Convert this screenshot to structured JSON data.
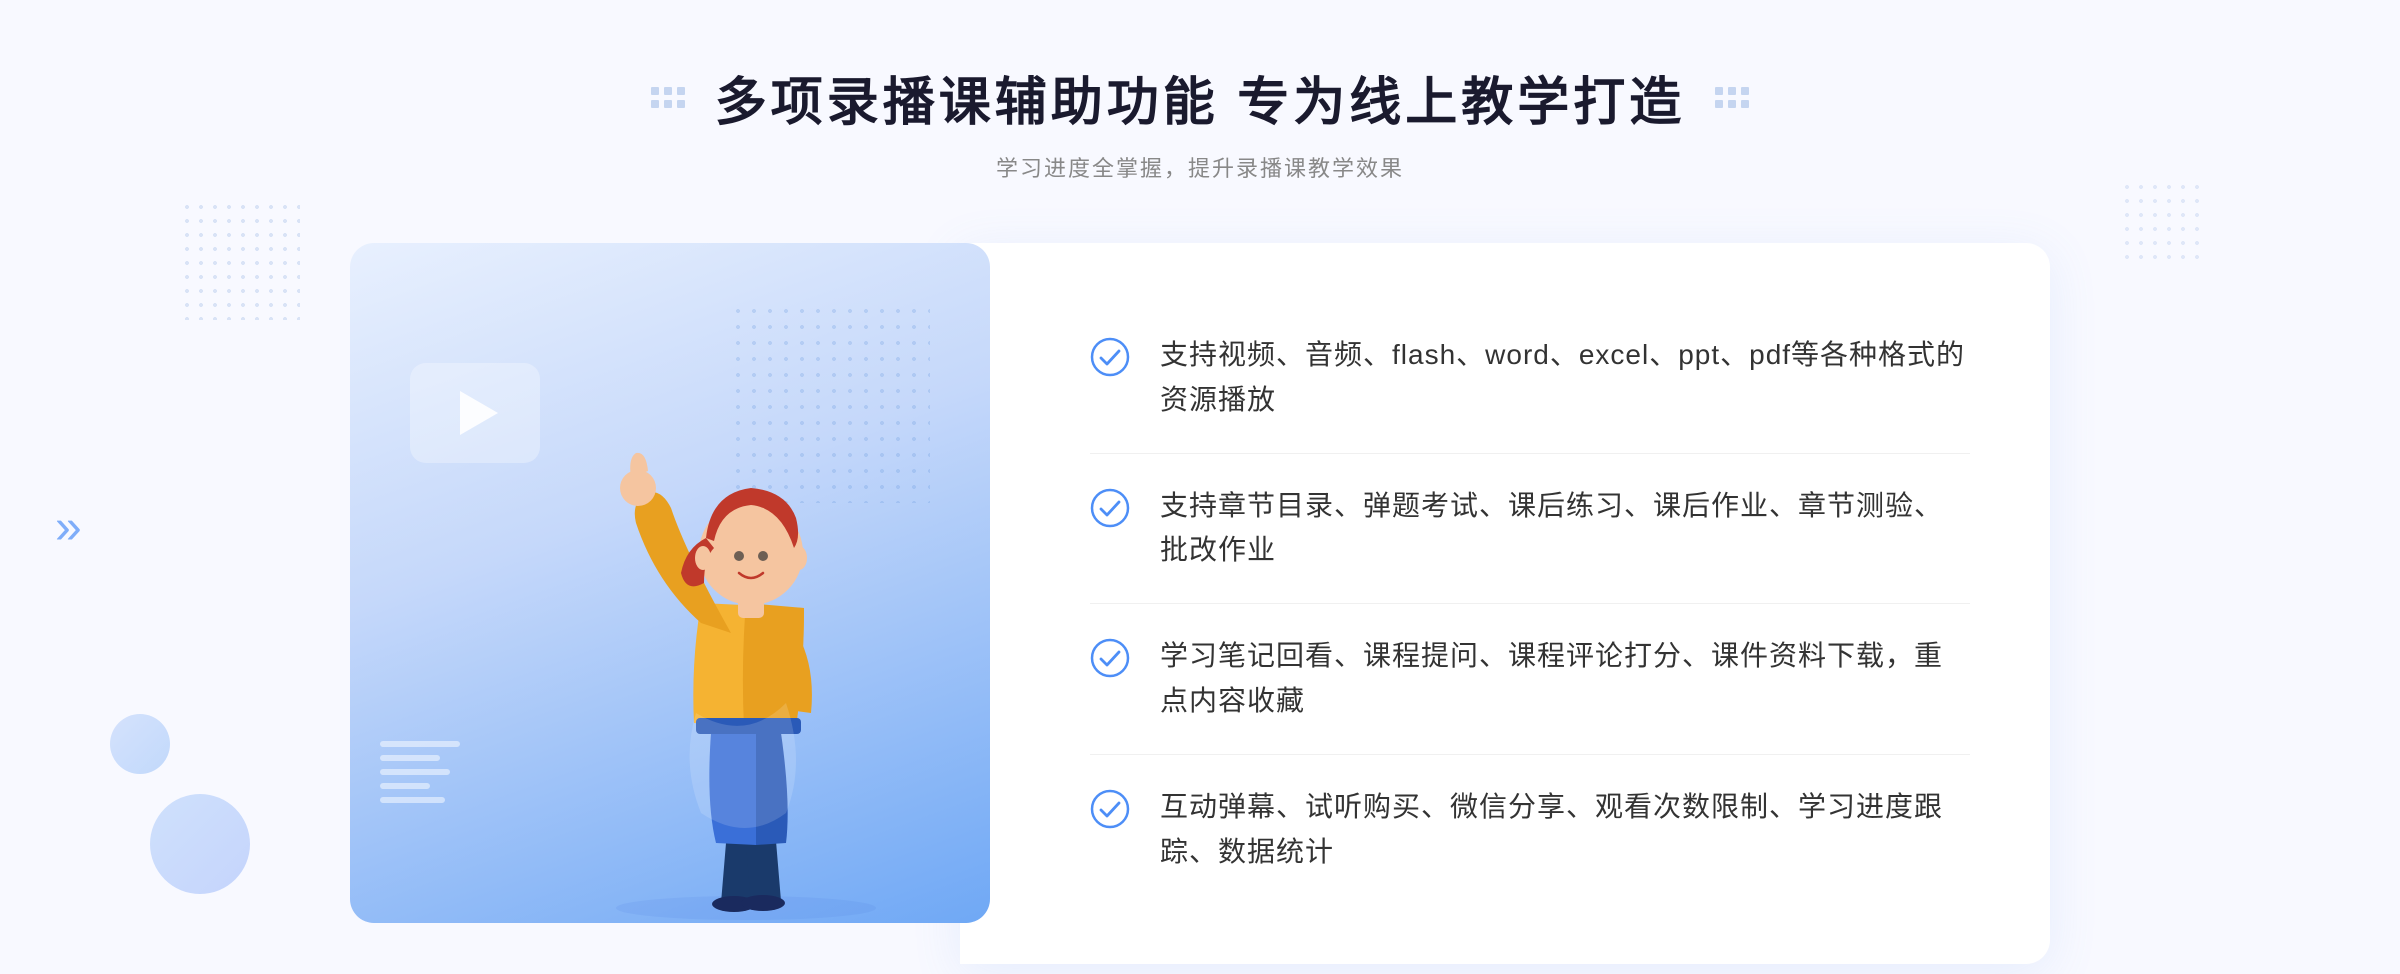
{
  "page": {
    "background": "#f8f9ff"
  },
  "header": {
    "main_title": "多项录播课辅助功能 专为线上教学打造",
    "subtitle": "学习进度全掌握，提升录播课教学效果",
    "title_dots_label": "decorative dots"
  },
  "features": [
    {
      "id": 1,
      "text": "支持视频、音频、flash、word、excel、ppt、pdf等各种格式的资源播放"
    },
    {
      "id": 2,
      "text": "支持章节目录、弹题考试、课后练习、课后作业、章节测验、批改作业"
    },
    {
      "id": 3,
      "text": "学习笔记回看、课程提问、课程评论打分、课件资料下载，重点内容收藏"
    },
    {
      "id": 4,
      "text": "互动弹幕、试听购买、微信分享、观看次数限制、学习进度跟踪、数据统计"
    }
  ],
  "icons": {
    "play": "▶",
    "check": "✓",
    "arrow_right": "»"
  },
  "colors": {
    "primary_blue": "#4d8ef7",
    "light_blue": "#6fa8f5",
    "bg_gradient_start": "#d8e8fb",
    "bg_gradient_end": "#b8d0f8",
    "text_dark": "#1a1a2e",
    "text_mid": "#333333",
    "text_light": "#888888"
  }
}
